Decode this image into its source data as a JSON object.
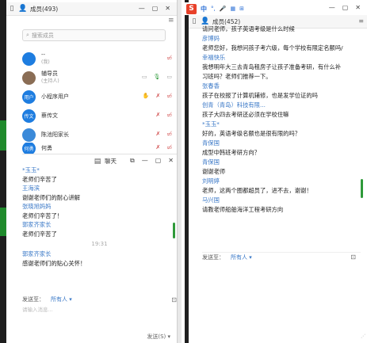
{
  "left": {
    "members_title": "成员(493)",
    "search_placeholder": "搜索成员",
    "members": [
      {
        "name": "--",
        "role": "(我)",
        "avatar": "",
        "color": "#1e7de0"
      },
      {
        "name": "辅导员",
        "role": "(主持人)",
        "avatar": "",
        "color": "#8a6d55"
      },
      {
        "name": "小程序用户",
        "role": "",
        "avatar": "用户",
        "color": "#1e7de0"
      },
      {
        "name": "蔡传文",
        "role": "",
        "avatar": "传文",
        "color": "#1e7de0"
      },
      {
        "name": "陈池阳家长",
        "role": "",
        "avatar": "",
        "color": "#3b8ad9"
      },
      {
        "name": "何勇",
        "role": "",
        "avatar": "何勇",
        "color": "#1e7de0"
      }
    ],
    "chat_title": "聊天",
    "messages": [
      {
        "type": "name",
        "text": "*玉玉*"
      },
      {
        "type": "text",
        "text": "老师们辛苦了"
      },
      {
        "type": "name",
        "text": "王海滨"
      },
      {
        "type": "text",
        "text": "谢谢老师们的耐心讲解"
      },
      {
        "type": "name",
        "text": "张晓旭妈妈"
      },
      {
        "type": "text",
        "text": "老师们辛苦了！"
      },
      {
        "type": "name",
        "text": "郭家齐家长"
      },
      {
        "type": "text",
        "text": "老师们辛苦了"
      },
      {
        "type": "time",
        "text": "19:31"
      },
      {
        "type": "name",
        "text": "郭家齐家长"
      },
      {
        "type": "text",
        "text": "感谢老师们的贴心关怀！"
      }
    ],
    "send_to_label": "发送至：",
    "send_to_value": "所有人 ▾",
    "input_placeholder": "请输入消息...",
    "send_button": "发送(S)  ▾"
  },
  "right": {
    "ime_cn": "中",
    "members_title": "成员(452)",
    "messages": [
      {
        "type": "text",
        "text": "请问老师，孩子英语考级是什么时候"
      },
      {
        "type": "name",
        "text": "彦博妈"
      },
      {
        "type": "text",
        "text": "老师您好，我想问孩子考六级，每个学校有限定名额吗/"
      },
      {
        "type": "name",
        "text": "幸福快乐"
      },
      {
        "type": "text",
        "text": "我想明年大三去青岛租房子让孩子准备考研，有什么补"
      },
      {
        "type": "text",
        "text": "习班吗？老师们推荐一下。"
      },
      {
        "type": "name",
        "text": "张春香"
      },
      {
        "type": "text",
        "text": "孩子在校报了计算机辅修，也是发学位证的吗"
      },
      {
        "type": "name",
        "text": "创青（青岛）科技有限..."
      },
      {
        "type": "text",
        "text": "孩子大四去考研还必须在学校住嘛"
      },
      {
        "type": "name",
        "text": "*玉玉*"
      },
      {
        "type": "text",
        "text": "好的，英语考级名额也是很有限的吗？"
      },
      {
        "type": "name",
        "text": "青保国"
      },
      {
        "type": "text",
        "text": "成型中韩班考研方向？"
      },
      {
        "type": "name",
        "text": "青保国"
      },
      {
        "type": "text",
        "text": "谢谢老师"
      },
      {
        "type": "name",
        "text": "刘明婷"
      },
      {
        "type": "text",
        "text": "老师，这两个圈都超员了，进不去，谢谢！"
      },
      {
        "type": "name",
        "text": "马兴国"
      },
      {
        "type": "text",
        "text": "请教老师船舶海洋工程考研方向"
      }
    ],
    "send_to_label": "发送至：",
    "send_to_value": "所有人 ▾"
  }
}
